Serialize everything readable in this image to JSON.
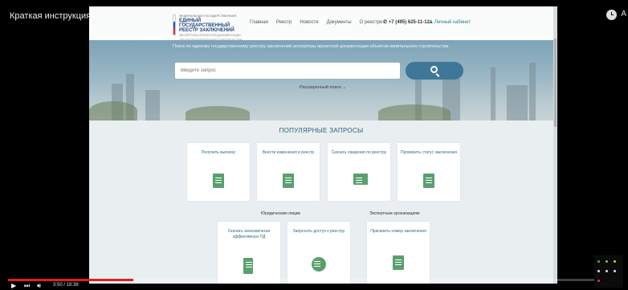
{
  "video": {
    "title": "Краткая инструкция по работе в ГИС ЕГРЗ",
    "corner_letter": "А",
    "time": "3:50 / 18:38",
    "progress": 0.205
  },
  "site": {
    "logo": {
      "line1": "ФЕДЕРАЛЬНАЯ ГОСУДАРСТВЕННАЯ",
      "line2": "ЕДИНЫЙ ГОСУДАРСТВЕННЫЙ",
      "line3": "РЕЕСТР ЗАКЛЮЧЕНИЙ",
      "line4": "ЭКСПЕРТИЗЫ ПРОЕКТНОЙ ДОКУМЕНТАЦИИ",
      "line5": "ОБЪЕКТОВ КАПИТАЛЬНОГО СТРОИТЕЛЬСТВА"
    },
    "nav": [
      "Главная",
      "Реестр",
      "Новости",
      "Документы",
      "О реестре"
    ],
    "phone": "+7 (495) 625-11-12",
    "cabinet": "Личный кабинет",
    "hero_caption": "Поиск по единому государственному реестру заключений экспертизы проектной документации объектов капитального строительства",
    "search_placeholder": "Введите запрос",
    "advanced_search": "Расширенный поиск",
    "popular_title": "ПОПУЛЯРНЫЕ ЗАПРОСЫ",
    "row1": [
      {
        "label": "Получить выписку",
        "icon": "document-pen-icon"
      },
      {
        "label": "Внести изменения в реестр",
        "icon": "edit-icon"
      },
      {
        "label": "Скачать сведения по реестру",
        "icon": "briefcase-icon"
      },
      {
        "label": "Проверить статус заключения",
        "icon": "status-document-icon"
      }
    ],
    "legal_entities": "Юридическим лицам",
    "expert_orgs": "Экспертным организациям",
    "row2": [
      {
        "label": "Скачать экономически эффективную ПД",
        "icon": "door-icon"
      },
      {
        "label": "Запросить доступ к реестру",
        "icon": "key-icon"
      },
      {
        "label": "Присвоить номер заключения",
        "icon": "document-gear-icon"
      }
    ]
  }
}
